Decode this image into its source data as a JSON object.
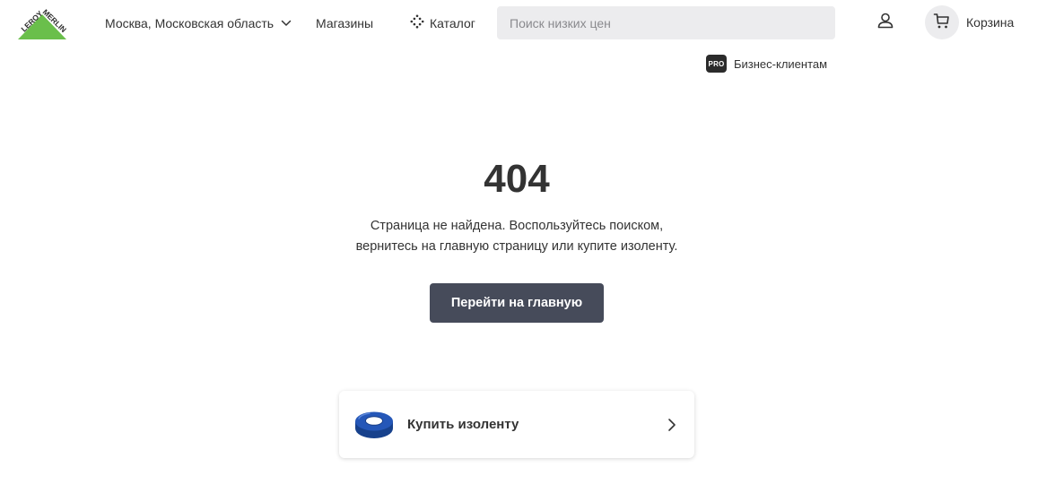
{
  "header": {
    "logo_text": "LEROY MERLIN",
    "region": "Москва, Московская область",
    "stores_label": "Магазины",
    "catalog_label": "Каталог",
    "search_placeholder": "Поиск низких цен",
    "cart_label": "Корзина",
    "pro_badge": "PRO",
    "pro_label": "Бизнес-клиентам"
  },
  "error": {
    "code": "404",
    "message_line1": "Страница не найдена. Воспользуйтесь поиском,",
    "message_line2": "вернитесь на главную страницу или купите изоленту.",
    "button_label": "Перейти на главную"
  },
  "promo": {
    "label": "Купить изоленту"
  },
  "colors": {
    "brand_green": "#6abf4b",
    "button_bg": "#464b5a",
    "search_bg": "#ececee",
    "text": "#333333",
    "tape_blue": "#1e4fa8"
  },
  "icons": {
    "region": "chevron-down-icon",
    "catalog": "catalog-dots-icon",
    "profile": "user-icon",
    "cart": "cart-icon",
    "promo_arrow": "chevron-right-icon"
  }
}
